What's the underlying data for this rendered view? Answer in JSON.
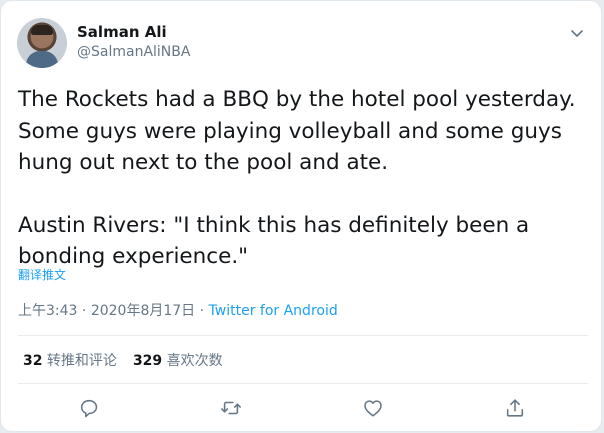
{
  "user": {
    "name": "Salman Ali",
    "handle": "@SalmanAliNBA"
  },
  "tweet": {
    "paragraph_1": "The Rockets had a BBQ by the hotel pool yesterday. Some guys were playing volleyball and some guys hung out next to the pool and ate.",
    "paragraph_2": "Austin Rivers: \"I think this has definitely been a bonding experience.\"",
    "translate_label": "翻译推文"
  },
  "meta": {
    "time": "上午3:43",
    "separator": " · ",
    "date": "2020年8月17日",
    "source": "Twitter for Android"
  },
  "stats": {
    "retweets_count": "32",
    "retweets_label": " 转推和评论",
    "likes_count": "329",
    "likes_label": " 喜欢次数"
  },
  "icons": {
    "menu": "chevron-down-icon",
    "reply": "reply-icon",
    "retweet": "retweet-icon",
    "like": "heart-icon",
    "share": "share-icon"
  },
  "colors": {
    "accent": "#1da1f2",
    "secondary_text": "#657786",
    "primary_text": "#14171a"
  }
}
